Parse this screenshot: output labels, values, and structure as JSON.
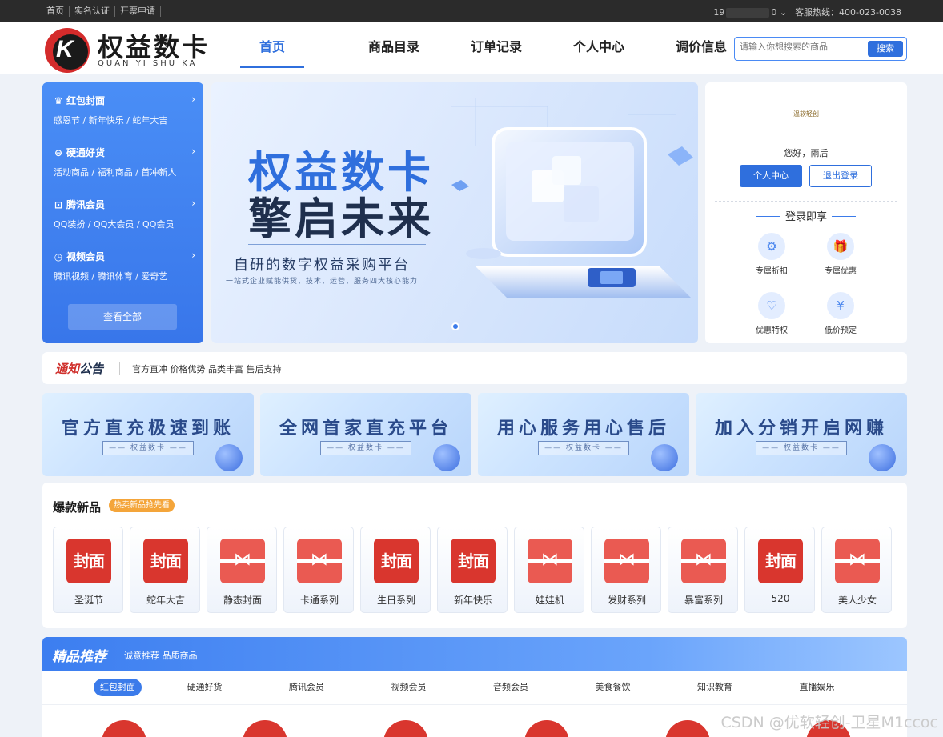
{
  "topbar": {
    "links": [
      "首页",
      "实名认证",
      "开票申请"
    ],
    "phone_prefix": "19",
    "phone_suffix": "0",
    "hotline": "客服热线：400-023-0038"
  },
  "header": {
    "logo_title": "权益数卡",
    "logo_sub": "QUAN YI SHU KA",
    "nav": [
      "首页",
      "商品目录",
      "订单记录",
      "个人中心",
      "调价信息"
    ],
    "search_placeholder": "请输入你想搜索的商品",
    "search_button": "搜索"
  },
  "categories": [
    {
      "icon": "红",
      "title": "红包封面",
      "sub": "感恩节 / 新年快乐 / 蛇年大吉"
    },
    {
      "icon": "硬",
      "title": "硬通好货",
      "sub": "活动商品 / 福利商品 / 首冲新人"
    },
    {
      "icon": "腾",
      "title": "腾讯会员",
      "sub": "QQ装扮 / QQ大会员 / QQ会员"
    },
    {
      "icon": "视",
      "title": "视频会员",
      "sub": "腾讯视频 / 腾讯体育 / 爱奇艺"
    }
  ],
  "view_all": "查看全部",
  "banner": {
    "line1": "权益数卡",
    "line2": "擎启未来",
    "line3": "自研的数字权益采购平台",
    "line4": "一站式企业赋能供货、技术、运营、服务四大核心能力"
  },
  "user": {
    "avatar_text": "温软轻创",
    "greeting": "您好，雨后",
    "center_button": "个人中心",
    "logout_button": "退出登录",
    "login_title": "登录即享",
    "features": [
      {
        "icon": "⚙",
        "label": "专属折扣"
      },
      {
        "icon": "🎁",
        "label": "专属优惠"
      },
      {
        "icon": "♡",
        "label": "优惠特权"
      },
      {
        "icon": "¥",
        "label": "低价预定"
      }
    ]
  },
  "notice": {
    "title_red": "通知",
    "title_dark": "公告",
    "text": "官方直冲 价格优势 品类丰富 售后支持"
  },
  "promos": [
    {
      "title": "官方直充极速到账",
      "sub": "—— 权益数卡 ——"
    },
    {
      "title": "全网首家直充平台",
      "sub": "—— 权益数卡 ——"
    },
    {
      "title": "用心服务用心售后",
      "sub": "—— 权益数卡 ——"
    },
    {
      "title": "加入分销开启网赚",
      "sub": "—— 权益数卡 ——"
    }
  ],
  "hot": {
    "title": "爆款新品",
    "badge": "热卖新品抢先看",
    "items": [
      {
        "label": "圣诞节",
        "kind": "cover",
        "text": "封面"
      },
      {
        "label": "蛇年大吉",
        "kind": "cover",
        "text": "封面"
      },
      {
        "label": "静态封面",
        "kind": "ribbon",
        "text": "⋈"
      },
      {
        "label": "卡通系列",
        "kind": "ribbon",
        "text": "⋈"
      },
      {
        "label": "生日系列",
        "kind": "cover",
        "text": "封面"
      },
      {
        "label": "新年快乐",
        "kind": "cover",
        "text": "封面"
      },
      {
        "label": "娃娃机",
        "kind": "ribbon",
        "text": "⋈"
      },
      {
        "label": "发财系列",
        "kind": "ribbon",
        "text": "⋈"
      },
      {
        "label": "暴富系列",
        "kind": "ribbon",
        "text": "⋈"
      },
      {
        "label": "520",
        "kind": "cover",
        "text": "封面"
      },
      {
        "label": "美人少女",
        "kind": "ribbon",
        "text": "⋈"
      }
    ]
  },
  "recommend": {
    "title": "精品推荐",
    "sub": "诚意推荐 品质商品",
    "tabs": [
      "红包封面",
      "硬通好货",
      "腾讯会员",
      "视频会员",
      "音频会员",
      "美食餐饮",
      "知识教育",
      "直播娱乐"
    ]
  },
  "watermark": "CSDN @优软轻创-卫星M1ccoc"
}
